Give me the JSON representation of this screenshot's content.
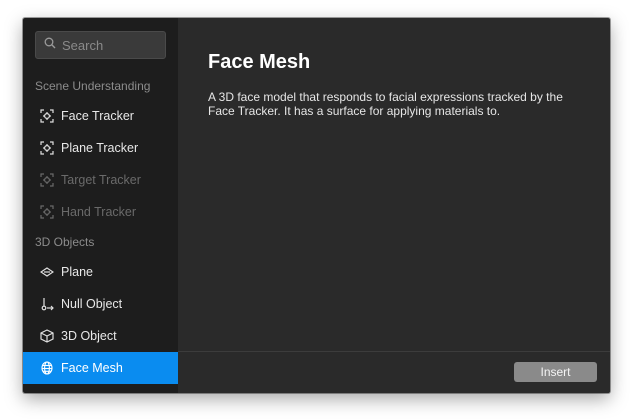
{
  "search": {
    "placeholder": "Search"
  },
  "sidebar": {
    "sections": [
      {
        "label": "Scene Understanding"
      },
      {
        "label": "3D Objects"
      }
    ],
    "items": [
      {
        "label": "Face Tracker",
        "icon": "tracker-icon",
        "state": "normal"
      },
      {
        "label": "Plane Tracker",
        "icon": "tracker-icon",
        "state": "normal"
      },
      {
        "label": "Target Tracker",
        "icon": "tracker-icon",
        "state": "disabled"
      },
      {
        "label": "Hand Tracker",
        "icon": "tracker-icon",
        "state": "disabled"
      },
      {
        "label": "Plane",
        "icon": "plane-icon",
        "state": "normal"
      },
      {
        "label": "Null Object",
        "icon": "null-object-icon",
        "state": "normal"
      },
      {
        "label": "3D Object",
        "icon": "cube-icon",
        "state": "normal"
      },
      {
        "label": "Face Mesh",
        "icon": "face-mesh-icon",
        "state": "selected"
      }
    ]
  },
  "detail": {
    "title": "Face Mesh",
    "description": "A 3D face model that responds to facial expressions tracked by the Face Tracker. It has a surface for applying materials to."
  },
  "footer": {
    "insert_label": "Insert"
  },
  "colors": {
    "sidebar_bg": "#1d1d1d",
    "main_bg": "#2a2a2a",
    "selected": "#0a8cf0",
    "button": "#8a8a8a"
  }
}
